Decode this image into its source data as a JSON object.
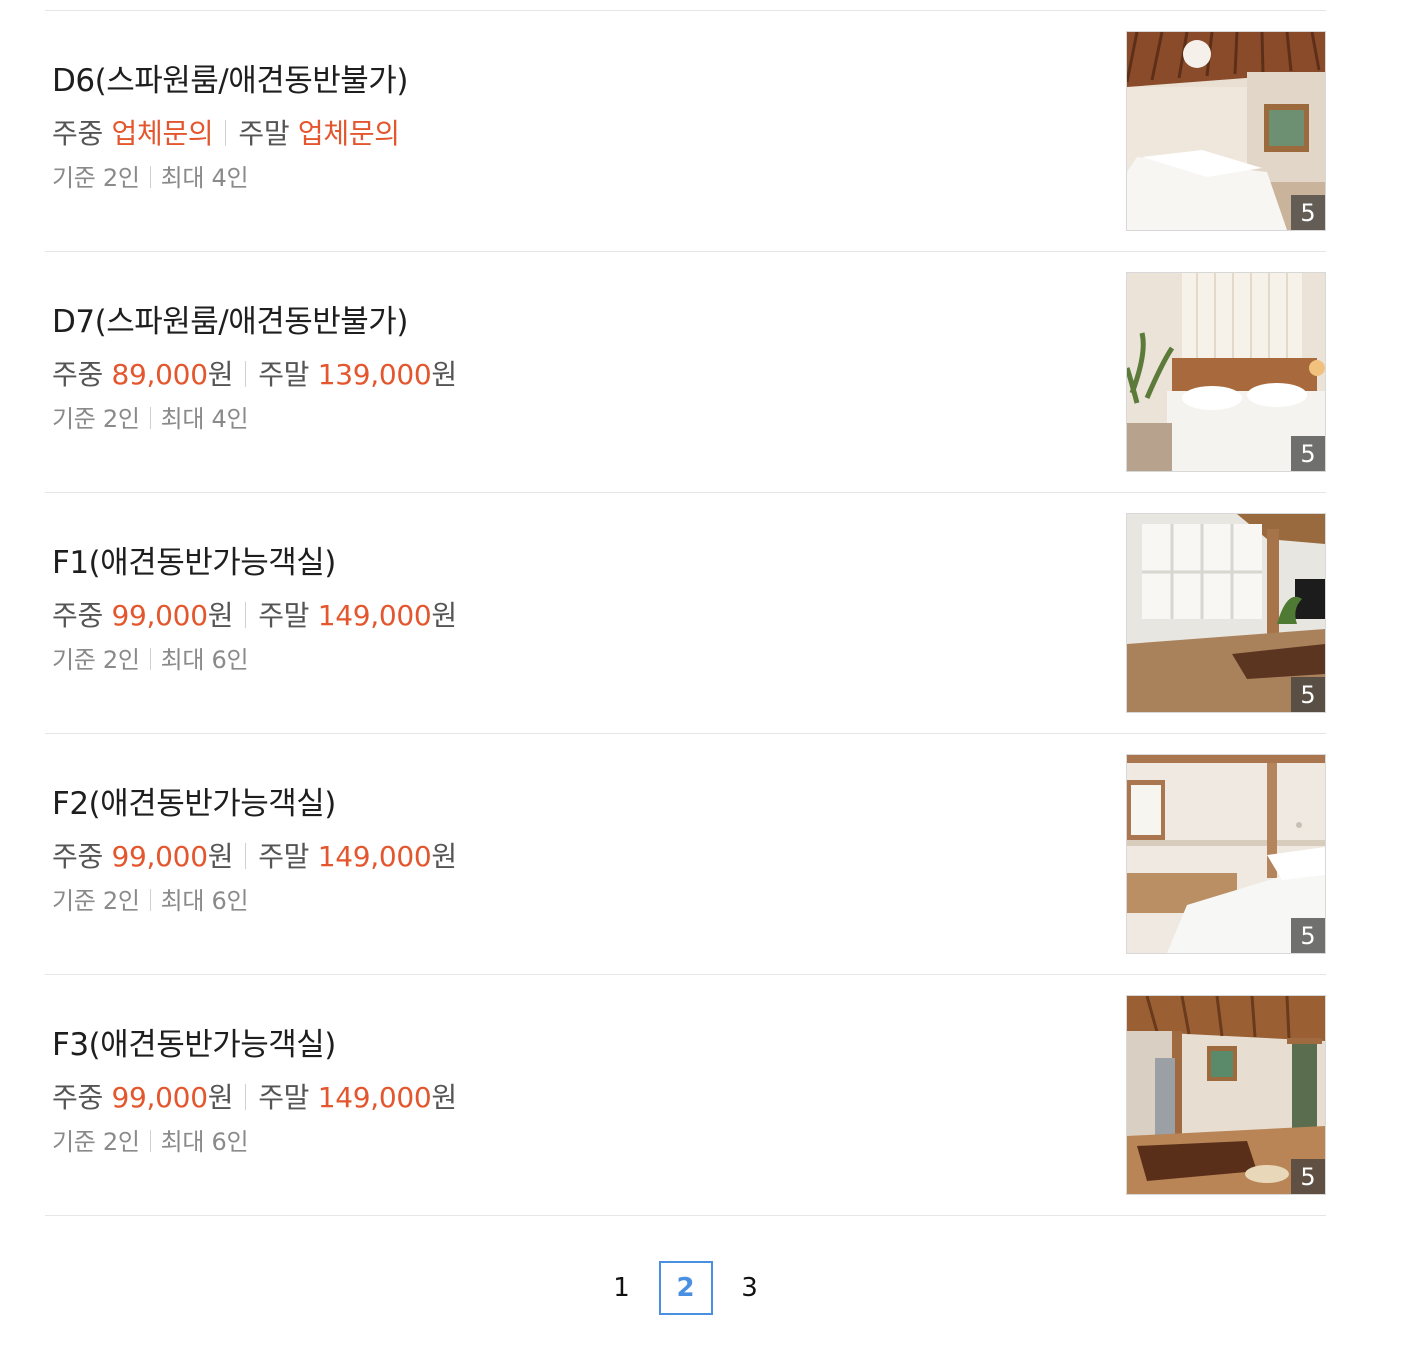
{
  "rooms": [
    {
      "name": "D6(스파원룸/애견동반불가)",
      "weekday_label": "주중",
      "weekday_price": "업체문의",
      "weekday_unit": "",
      "weekend_label": "주말",
      "weekend_price": "업체문의",
      "weekend_unit": "",
      "base_guests": "기준 2인",
      "max_guests": "최대 4인",
      "photo_count": "5"
    },
    {
      "name": "D7(스파원룸/애견동반불가)",
      "weekday_label": "주중",
      "weekday_price": "89,000",
      "weekday_unit": "원",
      "weekend_label": "주말",
      "weekend_price": "139,000",
      "weekend_unit": "원",
      "base_guests": "기준 2인",
      "max_guests": "최대 4인",
      "photo_count": "5"
    },
    {
      "name": "F1(애견동반가능객실)",
      "weekday_label": "주중",
      "weekday_price": "99,000",
      "weekday_unit": "원",
      "weekend_label": "주말",
      "weekend_price": "149,000",
      "weekend_unit": "원",
      "base_guests": "기준 2인",
      "max_guests": "최대 6인",
      "photo_count": "5"
    },
    {
      "name": "F2(애견동반가능객실)",
      "weekday_label": "주중",
      "weekday_price": "99,000",
      "weekday_unit": "원",
      "weekend_label": "주말",
      "weekend_price": "149,000",
      "weekend_unit": "원",
      "base_guests": "기준 2인",
      "max_guests": "최대 6인",
      "photo_count": "5"
    },
    {
      "name": "F3(애견동반가능객실)",
      "weekday_label": "주중",
      "weekday_price": "99,000",
      "weekday_unit": "원",
      "weekend_label": "주말",
      "weekend_price": "149,000",
      "weekend_unit": "원",
      "base_guests": "기준 2인",
      "max_guests": "최대 6인",
      "photo_count": "5"
    }
  ],
  "pagination": {
    "pages": [
      "1",
      "2",
      "3"
    ],
    "current": "2"
  },
  "colors": {
    "price_accent": "#e4572e",
    "active_page": "#4a90e2",
    "divider": "#e6e6e6"
  }
}
